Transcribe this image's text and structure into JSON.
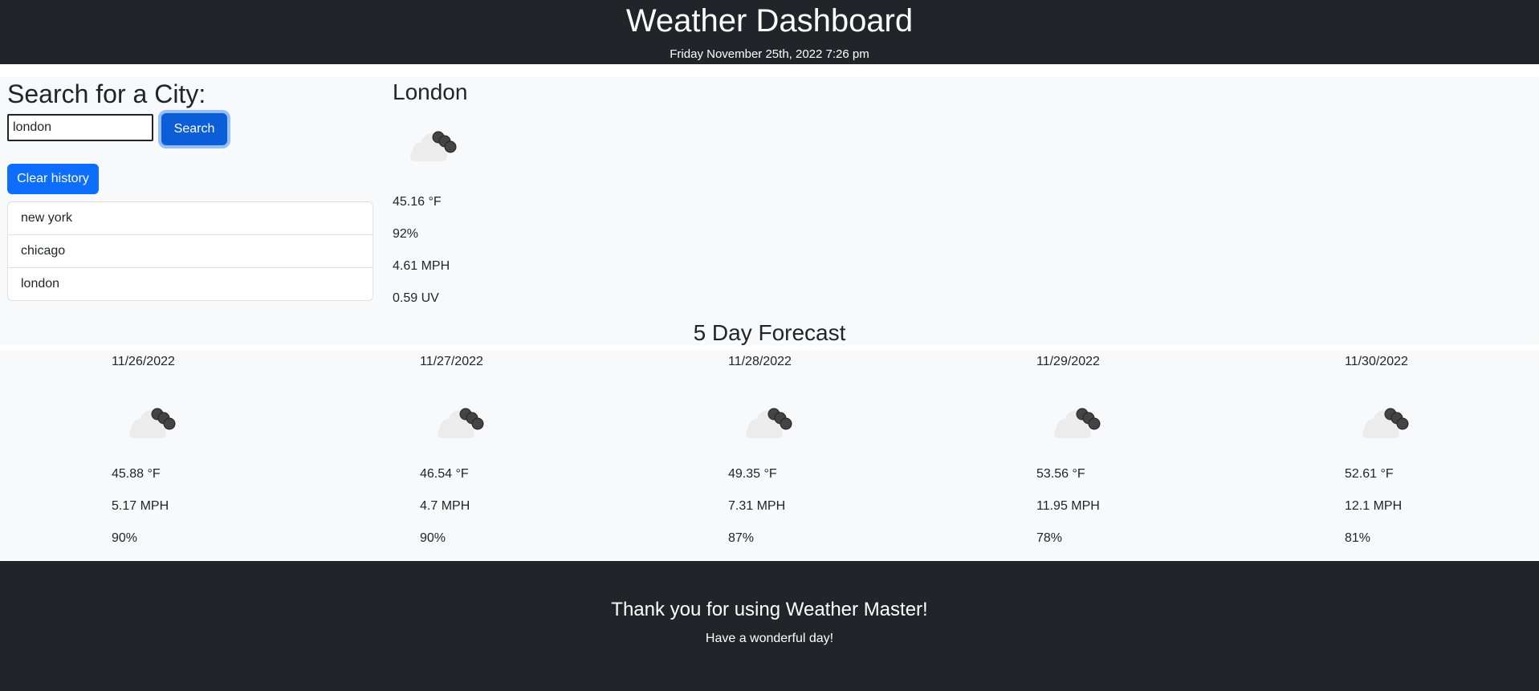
{
  "header": {
    "title": "Weather Dashboard",
    "datetime": "Friday November 25th, 2022 7:26 pm"
  },
  "search": {
    "heading": "Search for a City:",
    "input_value": "london",
    "button_label": "Search",
    "clear_label": "Clear history",
    "history": [
      "new york",
      "chicago",
      "london"
    ]
  },
  "current": {
    "city": "London",
    "icon": "cloudy-night-icon",
    "temp": "45.16 °F",
    "humidity": "92%",
    "wind": "4.61 MPH",
    "uv": "0.59 UV"
  },
  "forecast": {
    "title": "5 Day Forecast",
    "days": [
      {
        "date": "11/26/2022",
        "icon": "cloudy-night-icon",
        "temp": "45.88 °F",
        "wind": "5.17 MPH",
        "humidity": "90%"
      },
      {
        "date": "11/27/2022",
        "icon": "cloudy-night-icon",
        "temp": "46.54 °F",
        "wind": "4.7 MPH",
        "humidity": "90%"
      },
      {
        "date": "11/28/2022",
        "icon": "cloudy-night-icon",
        "temp": "49.35 °F",
        "wind": "7.31 MPH",
        "humidity": "87%"
      },
      {
        "date": "11/29/2022",
        "icon": "cloudy-night-icon",
        "temp": "53.56 °F",
        "wind": "11.95 MPH",
        "humidity": "78%"
      },
      {
        "date": "11/30/2022",
        "icon": "cloudy-night-icon",
        "temp": "52.61 °F",
        "wind": "12.1 MPH",
        "humidity": "81%"
      }
    ]
  },
  "footer": {
    "heading": "Thank you for using Weather Master!",
    "subtext": "Have a wonderful day!"
  },
  "colors": {
    "dark": "#212529",
    "primary": "#0d6efd",
    "panel": "#f8f9fa"
  }
}
